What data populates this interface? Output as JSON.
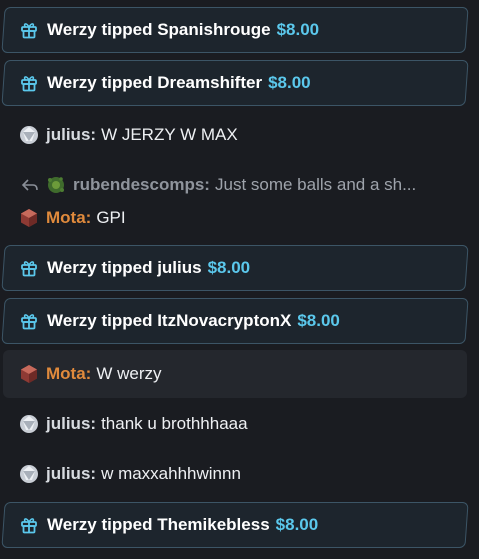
{
  "colors": {
    "accent": "#5bc8ec",
    "mota": "#e08a3c",
    "julius": "#d7dbe0"
  },
  "feed": {
    "tip1": {
      "icon": "gift-icon",
      "text": "Werzy tipped Spanishrouge",
      "amount": "$8.00"
    },
    "tip2": {
      "icon": "gift-icon",
      "text": "Werzy tipped Dreamshifter",
      "amount": "$8.00"
    },
    "msg1": {
      "avatar": "diamond-badge-icon",
      "user": "julius:",
      "text": "W JERZY W MAX"
    },
    "reply": {
      "icon": "reply-arrow-icon",
      "avatar": "green-badge-icon",
      "user": "rubendescomps:",
      "text": "Just some balls and a sh..."
    },
    "msg2": {
      "avatar": "ruby-badge-icon",
      "user": "Mota:",
      "text": "GPI"
    },
    "tip3": {
      "icon": "gift-icon",
      "text": "Werzy tipped julius",
      "amount": "$8.00"
    },
    "tip4": {
      "icon": "gift-icon",
      "text": "Werzy tipped ItzNovacryptonX",
      "amount": "$8.00"
    },
    "msg3": {
      "avatar": "ruby-badge-icon",
      "user": "Mota:",
      "text": "W werzy"
    },
    "msg4": {
      "avatar": "diamond-badge-icon",
      "user": "julius:",
      "text": "thank u brothhhaaa"
    },
    "msg5": {
      "avatar": "diamond-badge-icon",
      "user": "julius:",
      "text": "w maxxahhhwinnn"
    },
    "tip5": {
      "icon": "gift-icon",
      "text": "Werzy tipped Themikebless",
      "amount": "$8.00"
    }
  }
}
